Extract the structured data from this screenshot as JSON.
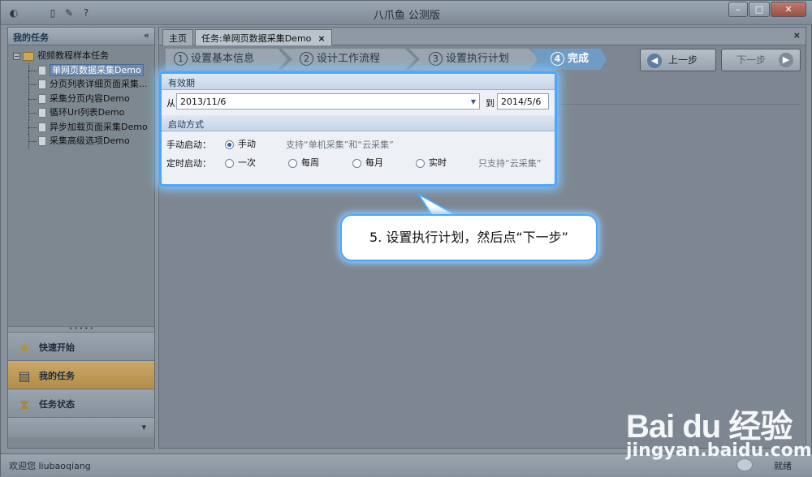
{
  "window": {
    "title": "八爪鱼 公测版"
  },
  "left_pane": {
    "header": "我的任务",
    "collapse_glyph": "«",
    "tree": {
      "root_toggle": "−",
      "root_label": "视频教程样本任务",
      "children": [
        "单网页数据采集Demo",
        "分页列表详细页面采集...",
        "采集分页内容Demo",
        "循环Url列表Demo",
        "异步加载页面采集Demo",
        "采集高级选项Demo"
      ]
    },
    "nav": [
      {
        "label": "快速开始",
        "icon": "star-icon"
      },
      {
        "label": "我的任务",
        "icon": "tasks-icon"
      },
      {
        "label": "任务状态",
        "icon": "hourglass-icon"
      }
    ],
    "more_glyph": "▾"
  },
  "tabs": [
    {
      "label": "主页"
    },
    {
      "label": "任务:单网页数据采集Demo",
      "close": "×"
    }
  ],
  "main_close": "×",
  "steps": [
    {
      "num": "1",
      "label": "设置基本信息"
    },
    {
      "num": "2",
      "label": "设计工作流程"
    },
    {
      "num": "3",
      "label": "设置执行计划"
    },
    {
      "num": "4",
      "label": "完成"
    }
  ],
  "buttons": {
    "prev": "上一步",
    "next": "下一步",
    "prev_arrow": "◀",
    "next_arrow": "▶"
  },
  "config": {
    "validity_header": "有效期",
    "from_label": "从",
    "from_date": "2013/11/6",
    "to_label": "到",
    "to_date": "2014/5/6",
    "start_header": "启动方式",
    "manual_label": "手动启动：",
    "manual_option": "手动",
    "manual_note": "支持“单机采集”和“云采集”",
    "timed_label": "定时启动：",
    "timed_options": [
      "一次",
      "每周",
      "每月",
      "实时"
    ],
    "timed_note": "只支持“云采集”"
  },
  "callout": "5. 设置执行计划，然后点“下一步”",
  "status": {
    "welcome": "欢迎您 liubaoqiang",
    "right": "就绪"
  },
  "watermark": {
    "logo": "Bai du 经验",
    "url": "jingyan.baidu.com"
  }
}
